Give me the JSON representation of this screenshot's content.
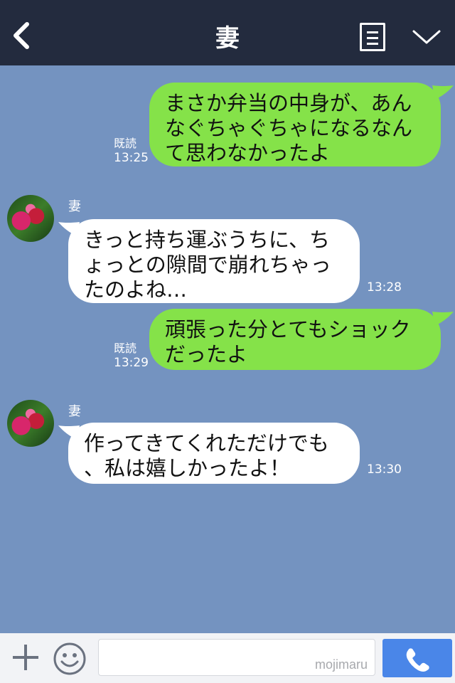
{
  "header": {
    "title": "妻",
    "back_icon": "chevron-left-icon",
    "menu_icon": "document-list-icon",
    "more_icon": "chevron-down-icon"
  },
  "messages": [
    {
      "side": "me",
      "text": "まさか弁当の中身が、あん\nなぐちゃぐちゃになるなん\nて思わなかったよ",
      "read": "既読",
      "time": "13:25"
    },
    {
      "side": "them",
      "sender": "妻",
      "text": "きっと持ち運ぶうちに、ち\nょっとの隙間で崩れちゃっ\nたのよね…",
      "time": "13:28"
    },
    {
      "side": "me",
      "text": "頑張った分とてもショック\nだったよ",
      "read": "既読",
      "time": "13:29"
    },
    {
      "side": "them",
      "sender": "妻",
      "text": "作ってきてくれただけでも\n、私は嬉しかったよ！",
      "time": "13:30"
    }
  ],
  "footer": {
    "watermark": "mojimaru",
    "plus_icon": "plus-icon",
    "emoji_icon": "smiley-icon",
    "call_icon": "phone-icon"
  },
  "colors": {
    "background": "#7493c0",
    "header": "#232b3e",
    "my_bubble": "#85e249",
    "their_bubble": "#ffffff",
    "call_button": "#4a86e8"
  }
}
